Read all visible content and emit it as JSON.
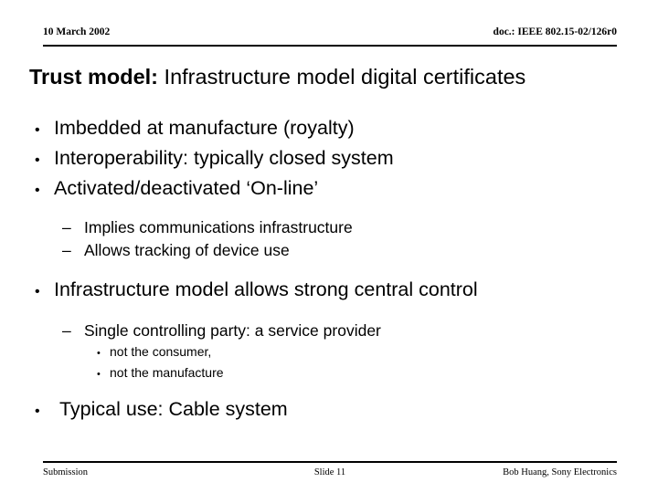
{
  "header": {
    "date": "10 March 2002",
    "doc": "doc.: IEEE 802.15-02/126r0"
  },
  "title": {
    "strong": "Trust model:",
    "rest": " Infrastructure model digital certificates"
  },
  "content": {
    "markers": {
      "level1": "•",
      "level2": "–",
      "level3": "•"
    },
    "bullets": [
      {
        "level": 1,
        "text": "Imbedded at manufacture (royalty)"
      },
      {
        "level": 1,
        "text": "Interoperability: typically closed system"
      },
      {
        "level": 1,
        "text": "Activated/deactivated ‘On-line’"
      },
      {
        "level": 2,
        "text": "Implies communications infrastructure"
      },
      {
        "level": 2,
        "text": "Allows tracking of device use"
      },
      {
        "level": 1,
        "text": "Infrastructure model allows strong central control"
      },
      {
        "level": 2,
        "text": "Single controlling party: a service provider"
      },
      {
        "level": 3,
        "text": "not the consumer,"
      },
      {
        "level": 3,
        "text": "not the manufacture"
      },
      {
        "level": 1,
        "text": " Typical use: Cable system"
      }
    ]
  },
  "footer": {
    "left": "Submission",
    "center": "Slide 11",
    "right": "Bob Huang, Sony Electronics"
  }
}
